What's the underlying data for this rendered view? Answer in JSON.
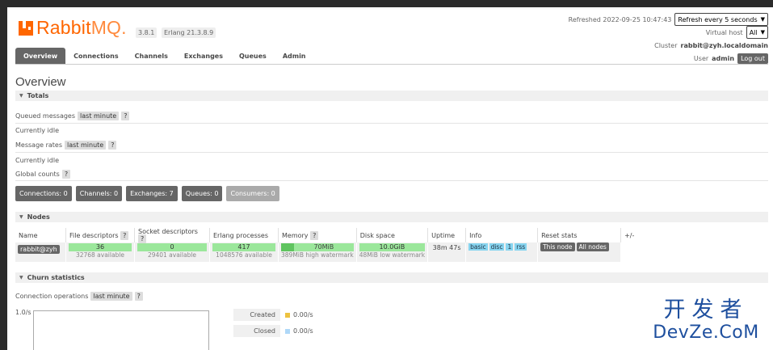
{
  "header": {
    "logo_rabbit": "Rabbit",
    "logo_mq": "MQ.",
    "version": "3.8.1",
    "erlang": "Erlang 21.3.8.9",
    "refreshed_label": "Refreshed 2022-09-25 10:47:43",
    "refresh_select": "Refresh every 5 seconds",
    "vhost_label": "Virtual host",
    "vhost_select": "All",
    "cluster_label": "Cluster",
    "cluster_value": "rabbit@zyh.localdomain",
    "user_label": "User",
    "user_value": "admin",
    "logout": "Log out"
  },
  "tabs": [
    "Overview",
    "Connections",
    "Channels",
    "Exchanges",
    "Queues",
    "Admin"
  ],
  "page_title": "Overview",
  "totals": {
    "title": "Totals",
    "queued_messages": "Queued messages",
    "last_minute": "last minute",
    "help": "?",
    "currently_idle": "Currently idle",
    "message_rates": "Message rates",
    "global_counts": "Global counts"
  },
  "counts": [
    {
      "label": "Connections: 0"
    },
    {
      "label": "Channels: 0"
    },
    {
      "label": "Exchanges: 7"
    },
    {
      "label": "Queues: 0"
    },
    {
      "label": "Consumers: 0"
    }
  ],
  "nodes": {
    "title": "Nodes",
    "headers": [
      "Name",
      "File descriptors",
      "Socket descriptors",
      "Erlang processes",
      "Memory",
      "Disk space",
      "Uptime",
      "Info",
      "Reset stats",
      "+/-"
    ],
    "row": {
      "name": "rabbit@zyh",
      "fd": "36",
      "fd_avail": "32768 available",
      "sd": "0",
      "sd_avail": "29401 available",
      "ep": "417",
      "ep_avail": "1048576 available",
      "mem": "70MiB",
      "mem_wm": "389MiB high watermark",
      "disk": "10.0GiB",
      "disk_wm": "48MiB low watermark",
      "uptime": "38m 47s",
      "info": [
        "basic",
        "disc",
        "1",
        "rss"
      ],
      "reset": [
        "This node",
        "All nodes"
      ]
    }
  },
  "churn": {
    "title": "Churn statistics",
    "conn_ops": "Connection operations",
    "last_minute": "last minute",
    "help": "?",
    "ytick": "1.0/s",
    "legend": [
      {
        "label": "Created",
        "value": "0.00/s",
        "color": "#edc240"
      },
      {
        "label": "Closed",
        "value": "0.00/s",
        "color": "#afd8f8"
      }
    ]
  },
  "watermark": {
    "cn": "开发者",
    "en": "DevZe.CoM"
  }
}
